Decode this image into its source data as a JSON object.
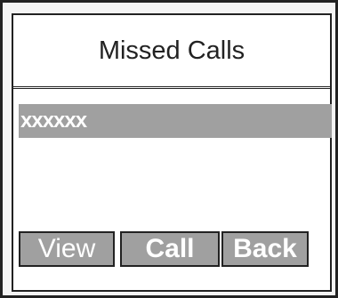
{
  "title": "Missed Calls",
  "list": {
    "selected_item": "xxxxxx"
  },
  "softkeys": {
    "left": "View",
    "middle": "Call",
    "right": "Back"
  }
}
